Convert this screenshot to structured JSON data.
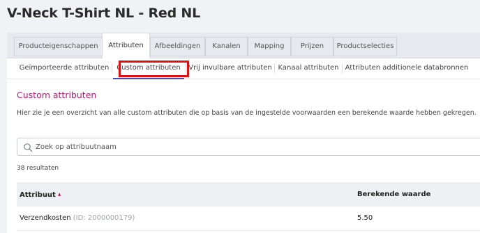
{
  "page": {
    "title": "V-Neck T-Shirt NL - Red NL"
  },
  "main_tabs": [
    {
      "label": "Producteigenschappen"
    },
    {
      "label": "Attributen",
      "active": true
    },
    {
      "label": "Afbeeldingen"
    },
    {
      "label": "Kanalen"
    },
    {
      "label": "Mapping"
    },
    {
      "label": "Prijzen"
    },
    {
      "label": "Productselecties"
    }
  ],
  "sub_tabs": [
    {
      "label": "Geïmporteerde attributen"
    },
    {
      "label": "Custom attributen",
      "active": true
    },
    {
      "label": "Vrij invulbare attributen"
    },
    {
      "label": "Kanaal attributen"
    },
    {
      "label": "Attributen additionele databronnen"
    }
  ],
  "section": {
    "title": "Custom attributen",
    "description": "Hier zie je een overzicht van alle custom attributen die op basis van de ingestelde voorwaarden een berekende waarde hebben gekregen."
  },
  "search": {
    "placeholder": "Zoek op attribuutnaam",
    "value": ""
  },
  "results": {
    "label": "38 resultaten"
  },
  "table": {
    "columns": {
      "attribute": "Attribuut",
      "value": "Berekende waarde"
    },
    "sort": {
      "column": "attribute",
      "direction": "asc",
      "icon": "sort-arrow-up-icon"
    },
    "rows": [
      {
        "attribute": "Verzendkosten",
        "id_text": "(ID: 2000000179)",
        "value": "5.50"
      }
    ]
  },
  "colors": {
    "accent": "#c0166c",
    "highlight": "#e01010",
    "active_tab_underline": "#3f51b5",
    "background": "#f1f2f6"
  }
}
